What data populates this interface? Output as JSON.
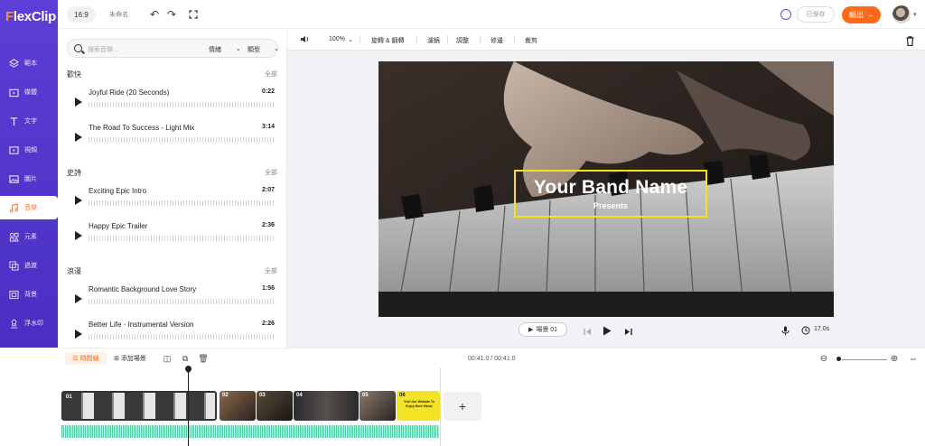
{
  "app": {
    "logo_prefix": "F",
    "logo_rest": "lexClip"
  },
  "topbar": {
    "ratio": "16:9",
    "project_name": "未命名",
    "saved_label": "已保存",
    "export_label": "輸出"
  },
  "rail": {
    "items": [
      {
        "label": "範本",
        "icon": "layers-icon"
      },
      {
        "label": "媒體",
        "icon": "folder-icon"
      },
      {
        "label": "文字",
        "icon": "text-icon"
      },
      {
        "label": "視頻",
        "icon": "video-icon"
      },
      {
        "label": "圖片",
        "icon": "image-icon"
      },
      {
        "label": "音樂",
        "icon": "music-icon",
        "active": true
      },
      {
        "label": "元素",
        "icon": "elements-icon"
      },
      {
        "label": "過渡",
        "icon": "transition-icon"
      },
      {
        "label": "背景",
        "icon": "background-icon"
      },
      {
        "label": "浮水印",
        "icon": "watermark-icon"
      }
    ]
  },
  "music": {
    "search_placeholder": "搜索音樂...",
    "filter_mood": "情緒",
    "filter_genre": "類型",
    "all_label": "全部",
    "categories": [
      {
        "name": "歡快",
        "tracks": [
          {
            "title": "Joyful Ride (20 Seconds)",
            "duration": "0:22"
          },
          {
            "title": "The Road To Success - Light Mix",
            "duration": "3:14"
          }
        ]
      },
      {
        "name": "史詩",
        "tracks": [
          {
            "title": "Exciting Epic Intro",
            "duration": "2:07"
          },
          {
            "title": "Happy Epic Trailer",
            "duration": "2:36"
          }
        ]
      },
      {
        "name": "浪漫",
        "tracks": [
          {
            "title": "Romantic Background Love Story",
            "duration": "1:56"
          },
          {
            "title": "Better Life - Instrumental Version",
            "duration": "2:26"
          }
        ]
      }
    ]
  },
  "editor": {
    "zoom": "100%",
    "tools": [
      "旋轉 & 翻轉",
      "濾鏡",
      "調整",
      "修邊",
      "裁剪"
    ],
    "title_line1": "Your Band Name",
    "title_line2": "Presents",
    "scene_label": "場景 01",
    "duration": "17.0s"
  },
  "timeline": {
    "tab_label": "時間線",
    "add_scene": "添加場景",
    "time": "00:41.0 / 00:41.0",
    "clips": [
      {
        "num": "01",
        "color": "#3a3a3a"
      },
      {
        "num": "02",
        "color": "#7a5a3a"
      },
      {
        "num": "03",
        "color": "#5a4a3a"
      },
      {
        "num": "04",
        "color": "#2a2a2e"
      },
      {
        "num": "05",
        "color": "#6a5a4a"
      },
      {
        "num": "06",
        "color": "#f3e326"
      }
    ],
    "clip6_text": "Visit Our Website To Enjoy More Music"
  },
  "colors": {
    "brand": "#5b3fd6",
    "accent": "#ff6a1a",
    "title_box": "#f5e21a",
    "audio": "#43c59a"
  }
}
